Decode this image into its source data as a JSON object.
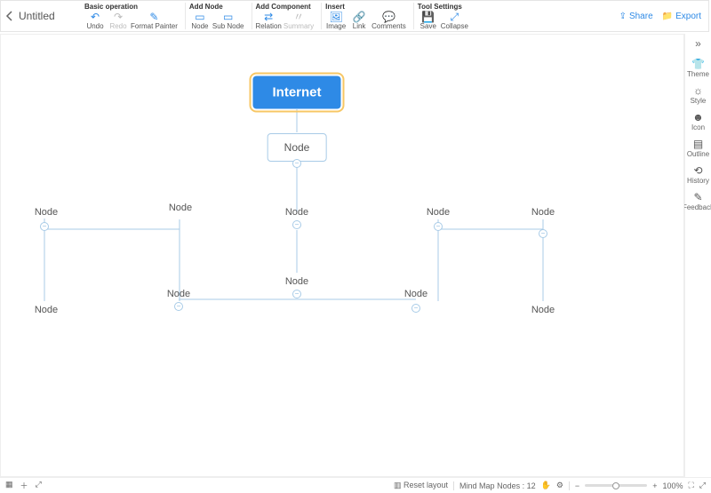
{
  "doc": {
    "title": "Untitled"
  },
  "ribbon": {
    "groups": {
      "basic": {
        "title": "Basic operation",
        "undo": "Undo",
        "redo": "Redo",
        "formatPainter": "Format Painter"
      },
      "addNode": {
        "title": "Add Node",
        "node": "Node",
        "subNode": "Sub Node"
      },
      "addComponent": {
        "title": "Add Component",
        "relation": "Relation",
        "summary": "Summary"
      },
      "insert": {
        "title": "Insert",
        "image": "Image",
        "link": "Link",
        "comments": "Comments"
      },
      "tool": {
        "title": "Tool Settings",
        "save": "Save",
        "collapse": "Collapse"
      }
    }
  },
  "headerRight": {
    "share": "Share",
    "export": "Export"
  },
  "rightPanel": {
    "theme": "Theme",
    "style": "Style",
    "icon": "Icon",
    "outline": "Outline",
    "history": "History",
    "feedback": "Feedback"
  },
  "canvas": {
    "root": "Internet",
    "boxNode": "Node",
    "labels": {
      "n1": "Node",
      "n2": "Node",
      "n3": "Node",
      "n4": "Node",
      "n5": "Node",
      "n6": "Node",
      "n7": "Node",
      "n8": "Node",
      "n9": "Node",
      "n10": "Node"
    }
  },
  "footer": {
    "resetLayout": "Reset layout",
    "nodeCountLabel": "Mind Map Nodes :",
    "nodeCount": "12",
    "zoom": "100%"
  }
}
